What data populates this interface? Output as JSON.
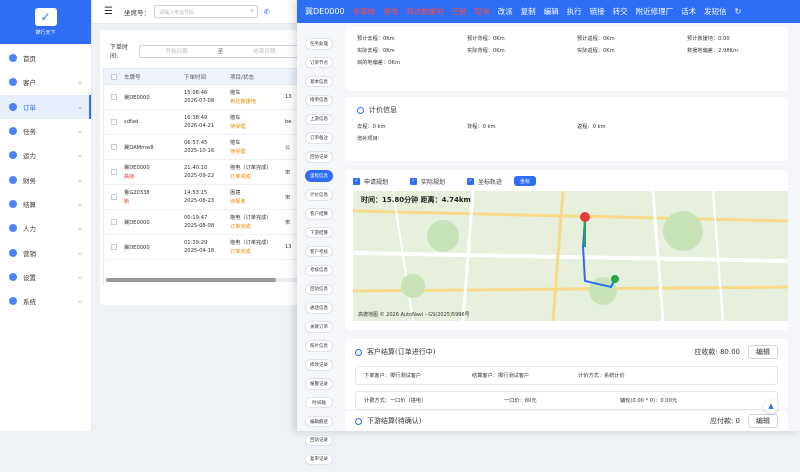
{
  "app": {
    "name": "撵行天下"
  },
  "sidebar": {
    "items": [
      {
        "label": "首页",
        "icon": "home-icon",
        "chevron": false
      },
      {
        "label": "客户",
        "icon": "user-icon",
        "chevron": true
      },
      {
        "label": "订单",
        "icon": "order-icon",
        "chevron": true,
        "active": true
      },
      {
        "label": "任务",
        "icon": "task-icon",
        "chevron": true
      },
      {
        "label": "运力",
        "icon": "truck-icon",
        "chevron": true
      },
      {
        "label": "财务",
        "icon": "finance-icon",
        "chevron": true
      },
      {
        "label": "结算",
        "icon": "settle-icon",
        "chevron": true
      },
      {
        "label": "人力",
        "icon": "people-icon",
        "chevron": true
      },
      {
        "label": "营销",
        "icon": "marketing-icon",
        "chevron": true
      },
      {
        "label": "设置",
        "icon": "settings-icon",
        "chevron": true
      },
      {
        "label": "系统",
        "icon": "system-icon",
        "chevron": true
      }
    ]
  },
  "topbar": {
    "seat_label": "坐席号：",
    "seat_placeholder": "请输入电话号码"
  },
  "filter": {
    "label": "下单时间:",
    "start_placeholder": "开始日期",
    "to": "至",
    "end_placeholder": "结束日期"
  },
  "table": {
    "headers": [
      "车牌号",
      "下单时间",
      "项目/状态",
      ""
    ],
    "rows": [
      {
        "plate": "冀DE0000",
        "plate_tag": "",
        "time": "15:08:46",
        "date": "2026-07-08",
        "project": "拖车",
        "status": "到达救援地",
        "status_color": "orange",
        "extra": "13"
      },
      {
        "plate": "sdfad",
        "plate_tag": "",
        "time": "16:38:49",
        "date": "2026-04-21",
        "project": "拖车",
        "status": "待受理",
        "status_color": "orange",
        "extra": "be"
      },
      {
        "plate": "冀DAMmw8",
        "plate_tag": "",
        "time": "06:57:45",
        "date": "2025-10-16",
        "project": "拖车",
        "status": "待受理",
        "status_color": "orange",
        "extra": "公"
      },
      {
        "plate": "冀DE0000",
        "plate_tag": "高级",
        "time": "21:40:10",
        "date": "2025-09-22",
        "project": "拖电（订单完成）",
        "status": "订单完成",
        "status_color": "orange",
        "extra": "宋"
      },
      {
        "plate": "鲁G20338",
        "plate_tag": "新",
        "time": "14:53:15",
        "date": "2025-08-23",
        "project": "困境",
        "status": "待报单",
        "status_color": "orange",
        "extra": "宋"
      },
      {
        "plate": "冀DE0000",
        "plate_tag": "",
        "time": "00:19:47",
        "date": "2025-08-08",
        "project": "拖电（订单完成）",
        "status": "订单完成",
        "status_color": "orange",
        "extra": "宋"
      },
      {
        "plate": "冀DE0000",
        "plate_tag": "",
        "time": "01:39:29",
        "date": "2025-04-18",
        "project": "拖电（订单完成）",
        "status": "订单完成",
        "status_color": "orange",
        "extra": "13"
      }
    ]
  },
  "detail": {
    "header": {
      "plate": "冀DE0000",
      "flag": "非事故",
      "service": "搭电",
      "status": "到达救援地",
      "actions": [
        "空驶",
        "取消",
        "改派",
        "复制",
        "编辑",
        "执行",
        "链接",
        "转交",
        "附近修理厂",
        "话术",
        "发短信"
      ],
      "refresh_icon": "refresh-icon"
    },
    "side_tabs": [
      "任务处理",
      "订单节点",
      "基本信息",
      "接单信息",
      "上游信息",
      "订单备注",
      "回访记录",
      "里程信息",
      "计价信息",
      "客户结算",
      "下游结算",
      "客户考核",
      "考核信息",
      "回访信息",
      "通话信息",
      "关联订单",
      "照片信息",
      "修改记录",
      "报警记录",
      "时间轴",
      "编辑痕迹",
      "回访记录",
      "复审记录"
    ],
    "active_tab": "里程信息",
    "mileage": {
      "rows": [
        [
          "预计去程：0Km",
          "预计背程：0Km",
          "预计返程：0Km",
          "预计救援地：0.00"
        ],
        [
          "实际去程：0Km",
          "实际背程：0Km",
          "实际返程：0Km",
          "救援地偏差：2.98Km"
        ],
        [
          "目的地偏差：0Km",
          "",
          "",
          ""
        ]
      ]
    },
    "pricing": {
      "title": "计价信息",
      "row": [
        "去程：0 km",
        "背程：0 km",
        "返程：0 km"
      ],
      "extra": "增补项目:"
    },
    "track": {
      "options": [
        "申请规划",
        "实际规划",
        "坐标轨迹"
      ],
      "button": "坐标",
      "map_info": "时间：15.80分钟  距离：4.74km",
      "map_logo": "高德地图 © 2026 AutoNavi - GS(2025)5996号",
      "places": [
        "石家庄市",
        "日社屋村",
        "西南村",
        "下新庄村",
        "杏苗公园",
        "杏苑路",
        "新华中学",
        "西三教村",
        "下营镇",
        "出拉庄村",
        "日升小区",
        "南沿王村",
        "新于村",
        "东胡村",
        "下新庄村"
      ]
    },
    "customer": {
      "title": "客户结算(订单进行中)",
      "receivable": "应收款: 80.00",
      "edit": "编辑",
      "order_customer": "下单客户：撵行测试客户",
      "settle_customer": "结算客户：撵行测试客户",
      "method": "计价方式：系统计价",
      "calc": "计费方式：一口价（搭电）",
      "price": "一口价：80元",
      "aux": "辅轮(0.00 * 0)：0.00元"
    },
    "downstream": {
      "title": "下游结算(待确认)",
      "payable": "应付款: 0",
      "edit": "编辑"
    }
  }
}
